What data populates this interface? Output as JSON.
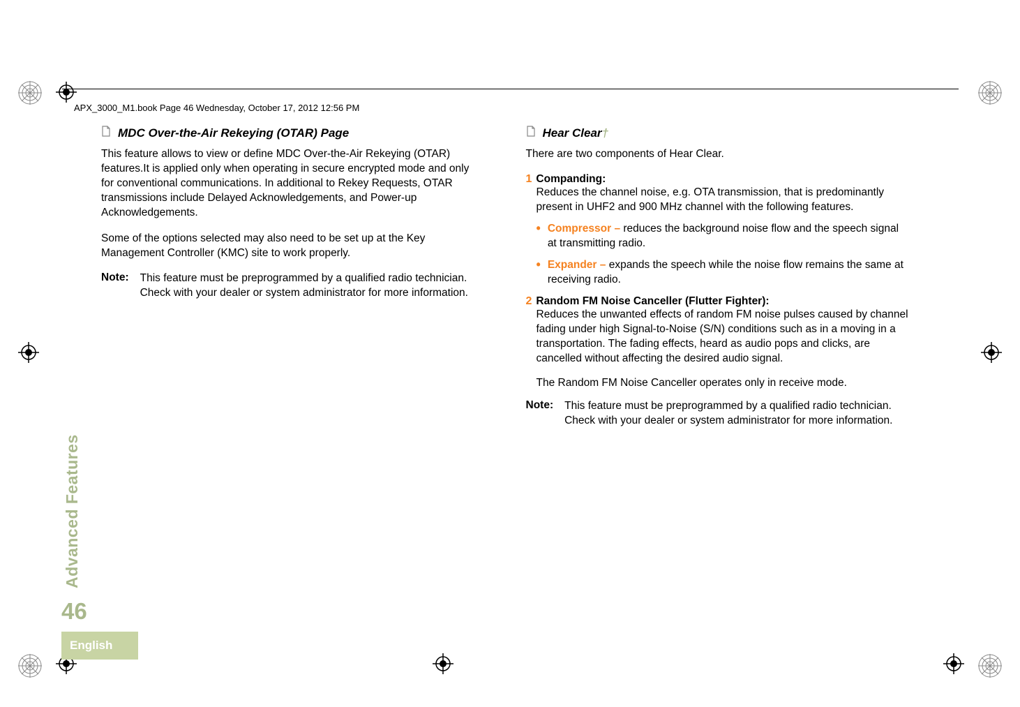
{
  "header": "APX_3000_M1.book  Page 46  Wednesday, October 17, 2012  12:56 PM",
  "sidebar_label": "Advanced Features",
  "page_number": "46",
  "language": "English",
  "left": {
    "section_title": "MDC Over-the-Air Rekeying (OTAR) Page",
    "para1": "This feature allows to view or define MDC Over-the-Air Rekeying (OTAR) features.It is applied only when operating in secure encrypted mode and only for conventional communications. In additional to Rekey Requests, OTAR transmissions include Delayed Acknowledgements, and Power-up Acknowledgements.",
    "para2": "Some of the options selected may also need to be set up at the Key Management Controller (KMC) site to work properly.",
    "note_label": "Note:",
    "note_text": "This feature must be preprogrammed by a qualified radio technician. Check with your dealer or system administrator for more information."
  },
  "right": {
    "section_title": "Hear Clear",
    "dagger": "†",
    "intro": "There are two components of Hear Clear.",
    "item1_num": "1",
    "item1_title": "Companding:",
    "item1_body": "Reduces the channel noise, e.g. OTA transmission, that is predominantly present in UHF2 and 900 MHz channel with the following features.",
    "bullets": [
      {
        "label": "Compressor",
        "dash": "–",
        "text": " reduces the background noise flow and the speech signal at transmitting radio."
      },
      {
        "label": "Expander",
        "dash": "–",
        "text": " expands the speech while the noise flow remains the same at receiving radio."
      }
    ],
    "item2_num": "2",
    "item2_title": "Random FM Noise Canceller (Flutter Fighter):",
    "item2_body": "Reduces the unwanted effects of random FM noise pulses caused by channel fading under high Signal-to-Noise (S/N) conditions such as in a moving in a transportation. The fading effects, heard as audio pops and clicks, are cancelled without affecting the desired audio signal.",
    "item2_body2": "The Random FM Noise Canceller operates only in receive mode.",
    "note_label": "Note:",
    "note_text": "This feature must be preprogrammed by a qualified radio technician. Check with your dealer or system administrator for more information."
  }
}
